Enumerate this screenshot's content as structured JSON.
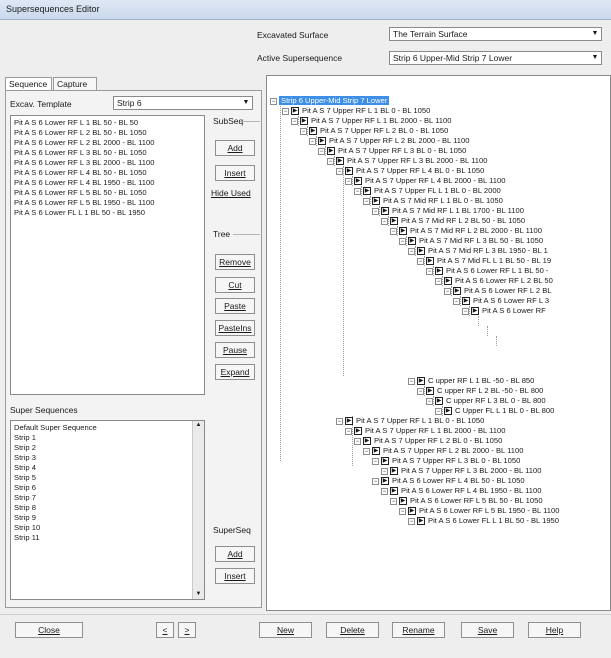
{
  "window": {
    "title": "Supersequences Editor"
  },
  "header": {
    "excavated_label": "Excavated Surface",
    "excavated_value": "The Terrain Surface",
    "active_label": "Active Supersequence",
    "active_value": "Strip 6 Upper-Mid Strip 7 Lower"
  },
  "tabs": [
    {
      "label": "Sequence"
    },
    {
      "label": "Capture"
    }
  ],
  "left": {
    "template_label": "Excav. Template",
    "template_value": "Strip 6",
    "subseq_list": [
      "Pit A S 6 Lower RF L 1 BL 50 - BL 50",
      "Pit A S 6 Lower RF L 2 BL 50 - BL 1050",
      "Pit A S 6 Lower RF L 2 BL 2000 - BL 1100",
      "Pit A S 6 Lower RF L 3 BL 50 - BL 1050",
      "Pit A S 6 Lower RF L 3 BL 2000 - BL 1100",
      "Pit A S 6 Lower RF L 4 BL 50 - BL 1050",
      "Pit A S 6 Lower RF L 4 BL 1950 - BL 1100",
      "Pit A S 6 Lower RF L 5 BL 50 - BL 1050",
      "Pit A S 6 Lower RF L 5 BL 1950 - BL 1100",
      "Pit A S 6 Lower FL L 1 BL 50 - BL 1950"
    ],
    "subseq_label": "SubSeq",
    "subseq_buttons": {
      "add": "Add",
      "insert": "Insert",
      "hide_used": "Hide Used"
    },
    "tree_label": "Tree",
    "tree_buttons": {
      "remove": "Remove",
      "cut": "Cut",
      "paste": "Paste",
      "pasteins": "PasteIns",
      "pause": "Pause",
      "expand": "Expand"
    },
    "super_label": "Super Sequences",
    "super_list": [
      "Default Super Sequence",
      "Strip 1",
      "Strip 2",
      "Strip 3",
      "Strip 4",
      "Strip 5",
      "Strip 6",
      "Strip 7",
      "Strip 8",
      "Strip 9",
      "Strip 10",
      "Strip 11"
    ],
    "superseq_label": "SuperSeq",
    "superseq_buttons": {
      "add": "Add",
      "insert": "Insert"
    }
  },
  "tree": {
    "root": "Strip 6 Upper-Mid Strip 7 Lower",
    "nodes": [
      "Pit A S 7 Upper RF L 1 BL 0 - BL 1050",
      "Pit A S 7 Upper RF L 1 BL 2000 - BL 1100",
      "Pit A S 7 Upper RF L 2 BL 0 - BL 1050",
      "Pit A S 7 Upper RF L 2 BL 2000 - BL 1100",
      "Pit A S 7 Upper RF L 3 BL 0 - BL 1050",
      "Pit A S 7 Upper RF L 3 BL 2000 - BL 1100",
      "Pit A S 7 Upper RF L 4 BL 0 - BL 1050",
      "Pit A S 7 Upper RF L 4 BL 2000 - BL 1100",
      "Pit A S 7 Upper FL L 1 BL 0 - BL 2000",
      "Pit A S 7 Mid RF L 1 BL 0 - BL 1050",
      "Pit A S 7 Mid RF L 1 BL 1700 - BL 1100",
      "Pit A S 7 Mid RF L 2 BL 50 - BL 1050",
      "Pit A S 7 Mid RF L 2 BL 2000 - BL 1100",
      "Pit A S 7 Mid RF L 3 BL 50 - BL 1050",
      "Pit A S 7 Mid RF L 3 BL 1950 - BL 1",
      "Pit A S 7 Mid FL L 1 BL 50 - BL 19",
      "Pit A S 6 Lower RF L 1 BL 50 -",
      "Pit A S 6 Lower RF L 2 BL 50",
      "Pit A S 6 Lower RF L 2 BL",
      "Pit A S 6 Lower RF L 3",
      "Pit A S 6 Lower RF",
      "C upper RF L 1 BL -50 - BL 850",
      "C upper RF L 2 BL -50 - BL 800",
      "C upper RF L 3 BL 0 - BL 800",
      "C Upper FL L 1 BL 0 - BL 800",
      "Pit A S 7 Upper RF L 1 BL 0 - BL 1050",
      "Pit A S 7 Upper RF L 1 BL 2000 - BL 1100",
      "Pit A S 7 Upper RF L 2 BL 0 - BL 1050",
      "Pit A S 7 Upper RF L 2 BL 2000 - BL 1100",
      "Pit A S 7 Upper RF L 3 BL 0 - BL 1050",
      "Pit A S 7 Upper RF L 3 BL 2000 - BL 1100",
      "Pit A S 6 Lower RF L 4 BL 50 - BL 1050",
      "Pit A S 6 Lower RF L 4 BL 1950 - BL 1100",
      "Pit A S 6 Lower RF L 5 BL 50 - BL 1050",
      "Pit A S 6 Lower RF L 5 BL 1950 - BL 1100",
      "Pit A S 6 Lower FL L 1 BL 50 - BL 1950"
    ]
  },
  "footer": {
    "close": "Close",
    "prev": "<",
    "next": ">",
    "new": "New",
    "delete": "Delete",
    "rename": "Rename",
    "save": "Save",
    "help": "Help"
  }
}
